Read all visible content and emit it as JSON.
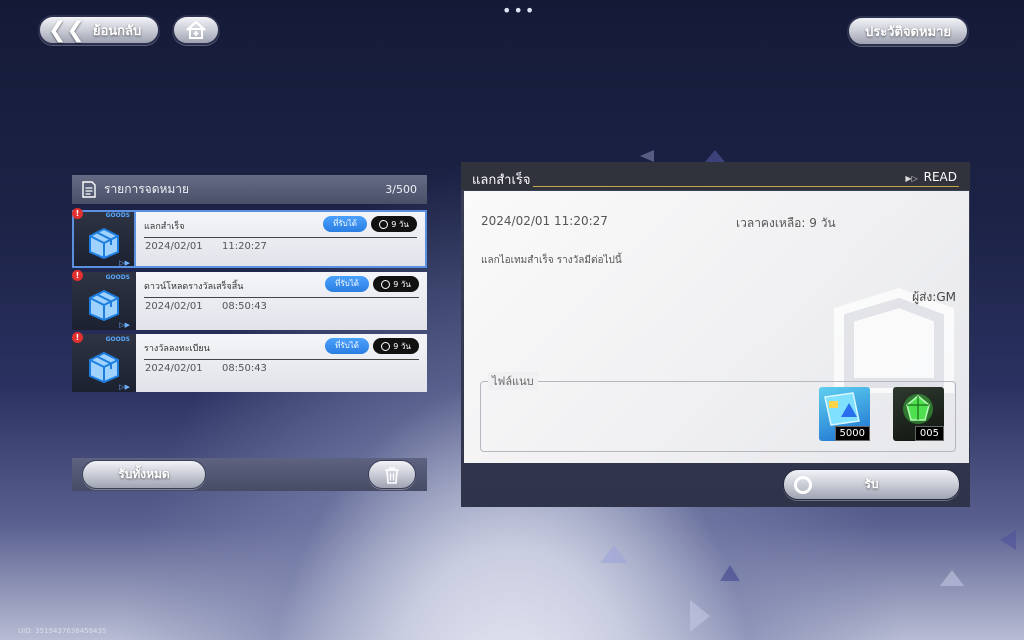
{
  "top_bar": {
    "back_label": "ย้อนกลับ",
    "history_label": "ประวัติจดหมาย",
    "menu_dots": "•••"
  },
  "mail_list": {
    "title": "รายการจดหมาย",
    "count": "3/500",
    "items": [
      {
        "category": "GOODS",
        "subject": "แลกสำเร็จ",
        "claim_badge": "ที่รับได้",
        "days_left": "9 วัน",
        "date": "2024/02/01",
        "time": "11:20:27",
        "selected": true
      },
      {
        "category": "GOODS",
        "subject": "ดาวน์โหลดรางวัลเสร็จสิ้น",
        "claim_badge": "ที่รับได้",
        "days_left": "9 วัน",
        "date": "2024/02/01",
        "time": "08:50:43",
        "selected": false
      },
      {
        "category": "GOODS",
        "subject": "รางวัลลงทะเบียน",
        "claim_badge": "ที่รับได้",
        "days_left": "9 วัน",
        "date": "2024/02/01",
        "time": "08:50:43",
        "selected": false
      }
    ],
    "claim_all_label": "รับทั้งหมด"
  },
  "detail": {
    "title": "แลกสำเร็จ",
    "status": "READ",
    "date": "2024/02/01",
    "time": "11:20:27",
    "time_remaining": "เวลาคงเหลือ: 9 วัน",
    "message": "แลกไอเทมสำเร็จ รางวัลมีต่อไปนี้",
    "sender": "ผู้ส่ง:GM",
    "attachments_label": "ไฟล์แนบ",
    "attachments": [
      {
        "name": "world-ticket",
        "quantity": "5000"
      },
      {
        "name": "green-crystal-item",
        "quantity": "005"
      }
    ],
    "receive_label": "รับ"
  },
  "footer": {
    "uid_text": "UID: 3519437636458435"
  },
  "colors": {
    "accent_blue": "#2a7ee0",
    "gold_line": "#c8a44a",
    "alert_red": "#e03030"
  }
}
